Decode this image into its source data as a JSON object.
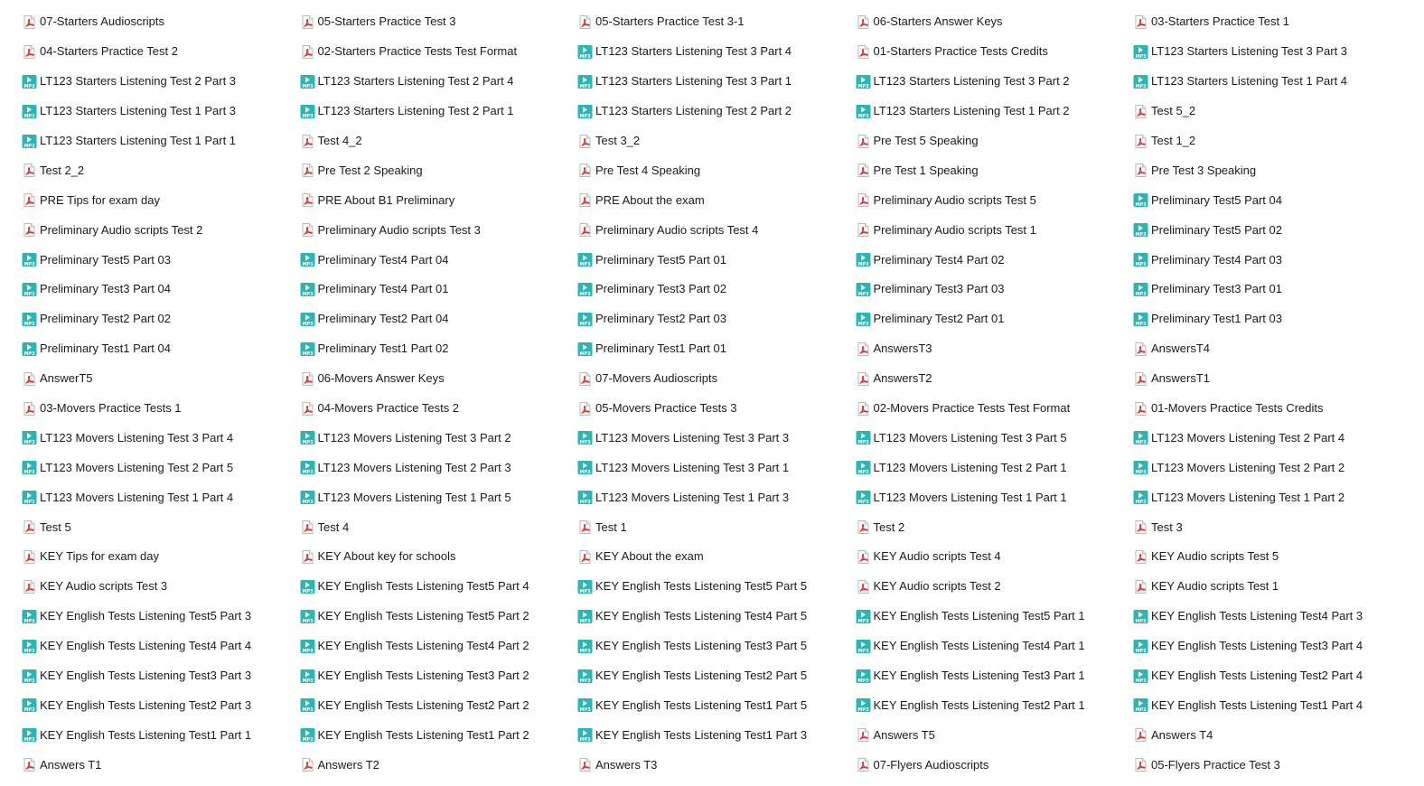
{
  "colors": {
    "pdf_icon": "#d9312b",
    "mp3_icon": "#2bb5b5",
    "text": "#1a1a1a",
    "background": "#ffffff"
  },
  "icon_types": {
    "pdf": "pdf-file-icon",
    "mp3": "mp3-file-icon"
  },
  "files": [
    {
      "name": "07-Starters Audioscripts",
      "type": "pdf"
    },
    {
      "name": "05-Starters Practice Test 3",
      "type": "pdf"
    },
    {
      "name": "05-Starters Practice Test 3-1",
      "type": "pdf"
    },
    {
      "name": "06-Starters Answer Keys",
      "type": "pdf"
    },
    {
      "name": "03-Starters Practice Test 1",
      "type": "pdf"
    },
    {
      "name": "04-Starters Practice Test 2",
      "type": "pdf"
    },
    {
      "name": "02-Starters Practice Tests Test Format",
      "type": "pdf"
    },
    {
      "name": "LT123 Starters Listening Test 3 Part 4",
      "type": "mp3"
    },
    {
      "name": "01-Starters Practice Tests Credits",
      "type": "pdf"
    },
    {
      "name": "LT123 Starters Listening Test 3 Part 3",
      "type": "mp3"
    },
    {
      "name": "LT123 Starters Listening Test 2 Part 3",
      "type": "mp3"
    },
    {
      "name": "LT123 Starters Listening Test 2 Part 4",
      "type": "mp3"
    },
    {
      "name": "LT123 Starters Listening Test 3 Part 1",
      "type": "mp3"
    },
    {
      "name": "LT123 Starters Listening Test 3 Part 2",
      "type": "mp3"
    },
    {
      "name": "LT123 Starters Listening Test 1 Part 4",
      "type": "mp3"
    },
    {
      "name": "LT123 Starters Listening Test 1 Part 3",
      "type": "mp3"
    },
    {
      "name": "LT123 Starters Listening Test 2 Part 1",
      "type": "mp3"
    },
    {
      "name": "LT123 Starters Listening Test 2 Part 2",
      "type": "mp3"
    },
    {
      "name": "LT123 Starters Listening Test 1 Part 2",
      "type": "mp3"
    },
    {
      "name": "Test 5_2",
      "type": "pdf"
    },
    {
      "name": "LT123 Starters Listening Test 1 Part 1",
      "type": "mp3"
    },
    {
      "name": "Test 4_2",
      "type": "pdf"
    },
    {
      "name": "Test 3_2",
      "type": "pdf"
    },
    {
      "name": "Pre Test 5 Speaking",
      "type": "pdf"
    },
    {
      "name": "Test 1_2",
      "type": "pdf"
    },
    {
      "name": "Test 2_2",
      "type": "pdf"
    },
    {
      "name": "Pre Test 2 Speaking",
      "type": "pdf"
    },
    {
      "name": "Pre Test 4 Speaking",
      "type": "pdf"
    },
    {
      "name": "Pre Test 1 Speaking",
      "type": "pdf"
    },
    {
      "name": "Pre Test 3 Speaking",
      "type": "pdf"
    },
    {
      "name": "PRE Tips for exam day",
      "type": "pdf"
    },
    {
      "name": "PRE About B1 Preliminary",
      "type": "pdf"
    },
    {
      "name": "PRE About the exam",
      "type": "pdf"
    },
    {
      "name": "Preliminary Audio scripts Test 5",
      "type": "pdf"
    },
    {
      "name": "Preliminary Test5 Part 04",
      "type": "mp3"
    },
    {
      "name": "Preliminary Audio scripts Test 2",
      "type": "pdf"
    },
    {
      "name": "Preliminary Audio scripts Test 3",
      "type": "pdf"
    },
    {
      "name": "Preliminary Audio scripts Test 4",
      "type": "pdf"
    },
    {
      "name": "Preliminary Audio scripts Test 1",
      "type": "pdf"
    },
    {
      "name": "Preliminary Test5 Part 02",
      "type": "mp3"
    },
    {
      "name": "Preliminary Test5 Part 03",
      "type": "mp3"
    },
    {
      "name": "Preliminary Test4 Part 04",
      "type": "mp3"
    },
    {
      "name": "Preliminary Test5 Part 01",
      "type": "mp3"
    },
    {
      "name": "Preliminary Test4 Part 02",
      "type": "mp3"
    },
    {
      "name": "Preliminary Test4 Part 03",
      "type": "mp3"
    },
    {
      "name": "Preliminary Test3 Part 04",
      "type": "mp3"
    },
    {
      "name": "Preliminary Test4 Part 01",
      "type": "mp3"
    },
    {
      "name": "Preliminary Test3 Part 02",
      "type": "mp3"
    },
    {
      "name": "Preliminary Test3 Part 03",
      "type": "mp3"
    },
    {
      "name": "Preliminary Test3 Part 01",
      "type": "mp3"
    },
    {
      "name": "Preliminary Test2 Part 02",
      "type": "mp3"
    },
    {
      "name": "Preliminary Test2 Part 04",
      "type": "mp3"
    },
    {
      "name": "Preliminary Test2 Part 03",
      "type": "mp3"
    },
    {
      "name": "Preliminary Test2 Part 01",
      "type": "mp3"
    },
    {
      "name": "Preliminary Test1 Part 03",
      "type": "mp3"
    },
    {
      "name": "Preliminary Test1 Part 04",
      "type": "mp3"
    },
    {
      "name": "Preliminary Test1 Part 02",
      "type": "mp3"
    },
    {
      "name": "Preliminary Test1 Part 01",
      "type": "mp3"
    },
    {
      "name": "AnswersT3",
      "type": "pdf"
    },
    {
      "name": "AnswersT4",
      "type": "pdf"
    },
    {
      "name": "AnswerT5",
      "type": "pdf"
    },
    {
      "name": "06-Movers Answer Keys",
      "type": "pdf"
    },
    {
      "name": "07-Movers Audioscripts",
      "type": "pdf"
    },
    {
      "name": "AnswersT2",
      "type": "pdf"
    },
    {
      "name": "AnswersT1",
      "type": "pdf"
    },
    {
      "name": "03-Movers Practice Tests 1",
      "type": "pdf"
    },
    {
      "name": "04-Movers Practice Tests 2",
      "type": "pdf"
    },
    {
      "name": "05-Movers Practice Tests 3",
      "type": "pdf"
    },
    {
      "name": "02-Movers Practice Tests Test Format",
      "type": "pdf"
    },
    {
      "name": "01-Movers Practice Tests Credits",
      "type": "pdf"
    },
    {
      "name": "LT123 Movers Listening Test 3 Part 4",
      "type": "mp3"
    },
    {
      "name": "LT123 Movers Listening Test 3 Part 2",
      "type": "mp3"
    },
    {
      "name": "LT123 Movers Listening Test 3 Part 3",
      "type": "mp3"
    },
    {
      "name": "LT123 Movers Listening Test 3 Part 5",
      "type": "mp3"
    },
    {
      "name": "LT123 Movers Listening Test 2 Part 4",
      "type": "mp3"
    },
    {
      "name": "LT123 Movers Listening Test 2 Part 5",
      "type": "mp3"
    },
    {
      "name": "LT123 Movers Listening Test 2 Part 3",
      "type": "mp3"
    },
    {
      "name": "LT123 Movers Listening Test 3 Part 1",
      "type": "mp3"
    },
    {
      "name": "LT123 Movers Listening Test 2 Part 1",
      "type": "mp3"
    },
    {
      "name": "LT123 Movers Listening Test 2 Part 2",
      "type": "mp3"
    },
    {
      "name": "LT123 Movers Listening Test 1 Part 4",
      "type": "mp3"
    },
    {
      "name": "LT123 Movers Listening Test 1 Part 5",
      "type": "mp3"
    },
    {
      "name": "LT123 Movers Listening Test 1 Part 3",
      "type": "mp3"
    },
    {
      "name": "LT123 Movers Listening Test 1 Part 1",
      "type": "mp3"
    },
    {
      "name": "LT123 Movers Listening Test 1 Part 2",
      "type": "mp3"
    },
    {
      "name": "Test 5",
      "type": "pdf"
    },
    {
      "name": "Test 4",
      "type": "pdf"
    },
    {
      "name": "Test 1",
      "type": "pdf"
    },
    {
      "name": "Test 2",
      "type": "pdf"
    },
    {
      "name": "Test 3",
      "type": "pdf"
    },
    {
      "name": "KEY Tips for exam day",
      "type": "pdf"
    },
    {
      "name": "KEY About key for schools",
      "type": "pdf"
    },
    {
      "name": "KEY About the exam",
      "type": "pdf"
    },
    {
      "name": "KEY Audio scripts Test 4",
      "type": "pdf"
    },
    {
      "name": "KEY Audio scripts Test 5",
      "type": "pdf"
    },
    {
      "name": "KEY Audio scripts Test 3",
      "type": "pdf"
    },
    {
      "name": "KEY English Tests Listening Test5 Part 4",
      "type": "mp3"
    },
    {
      "name": "KEY English Tests Listening Test5 Part 5",
      "type": "mp3"
    },
    {
      "name": "KEY Audio scripts Test 2",
      "type": "pdf"
    },
    {
      "name": "KEY Audio scripts Test 1",
      "type": "pdf"
    },
    {
      "name": "KEY English Tests Listening Test5 Part 3",
      "type": "mp3"
    },
    {
      "name": "KEY English Tests Listening Test5 Part 2",
      "type": "mp3"
    },
    {
      "name": "KEY English Tests Listening Test4 Part 5",
      "type": "mp3"
    },
    {
      "name": "KEY English Tests Listening Test5 Part 1",
      "type": "mp3"
    },
    {
      "name": "KEY English Tests Listening Test4 Part 3",
      "type": "mp3"
    },
    {
      "name": "KEY English Tests Listening Test4 Part 4",
      "type": "mp3"
    },
    {
      "name": "KEY English Tests Listening Test4 Part 2",
      "type": "mp3"
    },
    {
      "name": "KEY English Tests Listening Test3 Part 5",
      "type": "mp3"
    },
    {
      "name": "KEY English Tests Listening Test4 Part 1",
      "type": "mp3"
    },
    {
      "name": "KEY English Tests Listening Test3 Part 4",
      "type": "mp3"
    },
    {
      "name": "KEY English Tests Listening Test3 Part 3",
      "type": "mp3"
    },
    {
      "name": "KEY English Tests Listening Test3 Part 2",
      "type": "mp3"
    },
    {
      "name": "KEY English Tests Listening Test2 Part 5",
      "type": "mp3"
    },
    {
      "name": "KEY English Tests Listening Test3 Part 1",
      "type": "mp3"
    },
    {
      "name": "KEY English Tests Listening Test2 Part 4",
      "type": "mp3"
    },
    {
      "name": "KEY English Tests Listening Test2 Part 3",
      "type": "mp3"
    },
    {
      "name": "KEY English Tests Listening Test2 Part 2",
      "type": "mp3"
    },
    {
      "name": "KEY English Tests Listening Test1 Part 5",
      "type": "mp3"
    },
    {
      "name": "KEY English Tests Listening Test2 Part 1",
      "type": "mp3"
    },
    {
      "name": "KEY English Tests Listening Test1 Part 4",
      "type": "mp3"
    },
    {
      "name": "KEY English Tests Listening Test1 Part 1",
      "type": "mp3"
    },
    {
      "name": "KEY English Tests Listening Test1 Part 2",
      "type": "mp3"
    },
    {
      "name": "KEY English Tests Listening Test1 Part 3",
      "type": "mp3"
    },
    {
      "name": "Answers T5",
      "type": "pdf"
    },
    {
      "name": "Answers T4",
      "type": "pdf"
    },
    {
      "name": "Answers T1",
      "type": "pdf"
    },
    {
      "name": "Answers T2",
      "type": "pdf"
    },
    {
      "name": "Answers T3",
      "type": "pdf"
    },
    {
      "name": "07-Flyers Audioscripts",
      "type": "pdf"
    },
    {
      "name": "05-Flyers Practice Test 3",
      "type": "pdf"
    }
  ]
}
